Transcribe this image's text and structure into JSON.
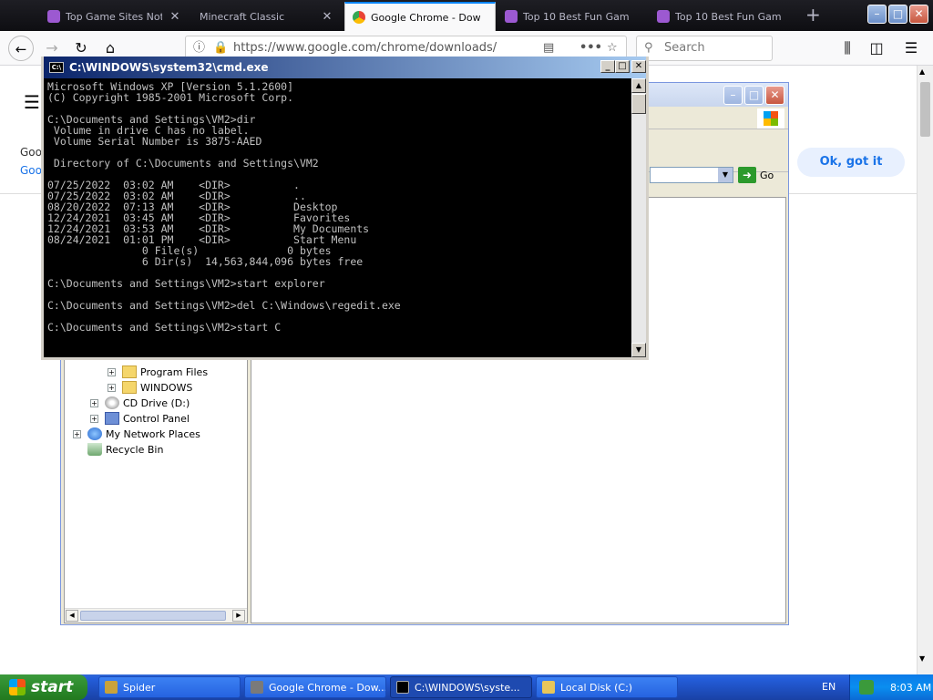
{
  "browser": {
    "tabs": [
      {
        "title": "Top Game Sites Not Bl",
        "fav_color": "#9c59d1",
        "active": false
      },
      {
        "title": "Minecraft Classic",
        "fav_color": "",
        "active": false
      },
      {
        "title": "Google Chrome - Dow",
        "fav_color": "#4285f4",
        "active": true
      },
      {
        "title": "Top 10 Best Fun Gam",
        "fav_color": "#9c59d1",
        "active": false
      },
      {
        "title": "Top 10 Best Fun Gam",
        "fav_color": "#9c59d1",
        "active": false
      }
    ],
    "url": "https://www.google.com/chrome/downloads/",
    "search_placeholder": "Search"
  },
  "page": {
    "text1": "Goo",
    "text2": "Goo",
    "ok_button": "Ok, got it"
  },
  "explorer": {
    "go_label": "Go",
    "tree": [
      {
        "label": "Program Files",
        "icon": "folder-icon",
        "expander": true
      },
      {
        "label": "WINDOWS",
        "icon": "folder-icon",
        "expander": true
      },
      {
        "label": "CD Drive (D:)",
        "icon": "cd-drive-icon",
        "expander": true
      },
      {
        "label": "Control Panel",
        "icon": "control-panel-icon",
        "expander": true
      },
      {
        "label": "My Network Places",
        "icon": "network-icon",
        "expander": true
      },
      {
        "label": "Recycle Bin",
        "icon": "recycle-bin-icon",
        "expander": false
      }
    ]
  },
  "cmd": {
    "title": "C:\\WINDOWS\\system32\\cmd.exe",
    "lines": [
      "Microsoft Windows XP [Version 5.1.2600]",
      "(C) Copyright 1985-2001 Microsoft Corp.",
      "",
      "C:\\Documents and Settings\\VM2>dir",
      " Volume in drive C has no label.",
      " Volume Serial Number is 3875-AAED",
      "",
      " Directory of C:\\Documents and Settings\\VM2",
      "",
      "07/25/2022  03:02 AM    <DIR>          .",
      "07/25/2022  03:02 AM    <DIR>          ..",
      "08/20/2022  07:13 AM    <DIR>          Desktop",
      "12/24/2021  03:45 AM    <DIR>          Favorites",
      "12/24/2021  03:53 AM    <DIR>          My Documents",
      "08/24/2021  01:01 PM    <DIR>          Start Menu",
      "               0 File(s)              0 bytes",
      "               6 Dir(s)  14,563,844,096 bytes free",
      "",
      "C:\\Documents and Settings\\VM2>start explorer",
      "",
      "C:\\Documents and Settings\\VM2>del C:\\Windows\\regedit.exe",
      "",
      "C:\\Documents and Settings\\VM2>start C"
    ]
  },
  "taskbar": {
    "start_label": "start",
    "tasks": [
      {
        "label": "Spider",
        "icon_color": "#c9a23a",
        "active": false
      },
      {
        "label": "Google Chrome - Dow...",
        "icon_color": "#7a7a7a",
        "active": false
      },
      {
        "label": "C:\\WINDOWS\\syste...",
        "icon_color": "#000000",
        "active": true
      },
      {
        "label": "Local Disk (C:)",
        "icon_color": "#e8c65a",
        "active": false
      }
    ],
    "lang": "EN",
    "clock": "8:03 AM"
  }
}
